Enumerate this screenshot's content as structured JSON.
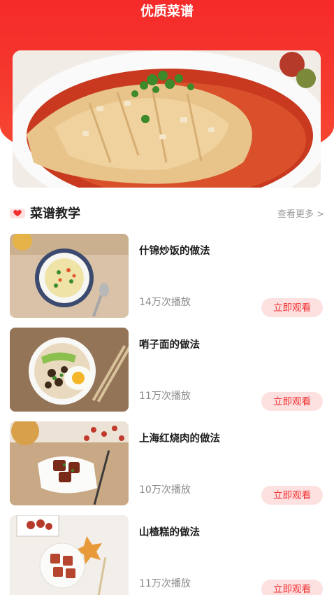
{
  "header": {
    "title": "优质菜谱"
  },
  "section": {
    "title": "菜谱教学",
    "more_label": "查看更多 >"
  },
  "recipes": [
    {
      "name": "什锦炒饭的做法",
      "plays": "14万次播放",
      "action": "立即观看"
    },
    {
      "name": "哨子面的做法",
      "plays": "11万次播放",
      "action": "立即观看"
    },
    {
      "name": "上海红烧肉的做法",
      "plays": "10万次播放",
      "action": "立即观看"
    },
    {
      "name": "山楂糕的做法",
      "plays": "11万次播放",
      "action": "立即观看"
    }
  ],
  "colors": {
    "brand_red": "#f52a2a",
    "button_bg": "#fde0e0",
    "button_text": "#f23030"
  }
}
